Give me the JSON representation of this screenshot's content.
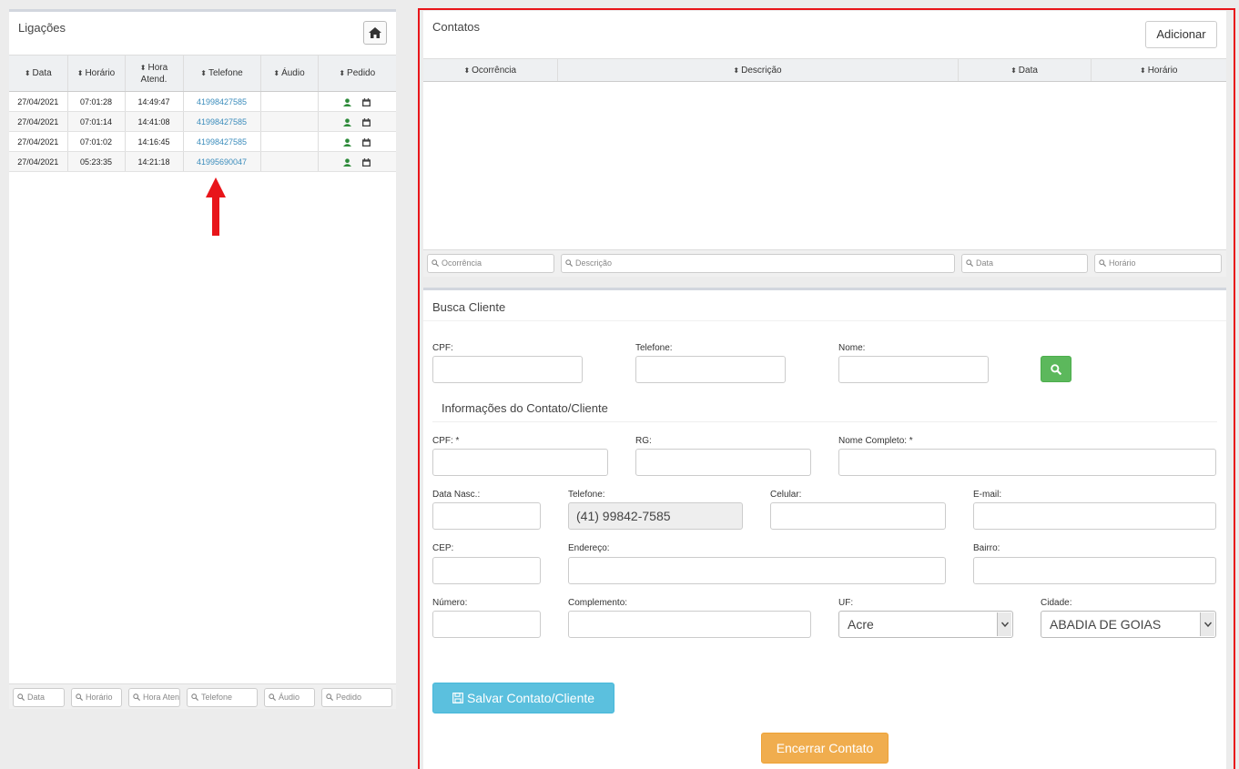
{
  "calls_panel": {
    "title": "Ligações",
    "columns": [
      "Data",
      "Horário",
      "Hora Atend.",
      "Telefone",
      "Áudio",
      "Pedido"
    ],
    "rows": [
      {
        "data": "27/04/2021",
        "horario": "07:01:28",
        "hora_atend": "14:49:47",
        "telefone": "41998427585"
      },
      {
        "data": "27/04/2021",
        "horario": "07:01:14",
        "hora_atend": "14:41:08",
        "telefone": "41998427585"
      },
      {
        "data": "27/04/2021",
        "horario": "07:01:02",
        "hora_atend": "14:16:45",
        "telefone": "41998427585"
      },
      {
        "data": "27/04/2021",
        "horario": "05:23:35",
        "hora_atend": "14:21:18",
        "telefone": "41995690047"
      }
    ],
    "filters": [
      "Data",
      "Horário",
      "Hora Atend.",
      "Telefone",
      "Áudio",
      "Pedido"
    ]
  },
  "contacts_panel": {
    "title": "Contatos",
    "add_label": "Adicionar",
    "columns": [
      "Ocorrência",
      "Descrição",
      "Data",
      "Horário"
    ],
    "filters": [
      "Ocorrência",
      "Descrição",
      "Data",
      "Horário"
    ]
  },
  "search_panel": {
    "title": "Busca Cliente",
    "cpf_label": "CPF:",
    "telefone_label": "Telefone:",
    "nome_label": "Nome:"
  },
  "info_panel": {
    "title": "Informações do Contato/Cliente",
    "cpf_label": "CPF: *",
    "rg_label": "RG:",
    "nome_completo_label": "Nome Completo: *",
    "data_nasc_label": "Data Nasc.:",
    "telefone_label": "Telefone:",
    "telefone_value": "(41) 99842-7585",
    "celular_label": "Celular:",
    "email_label": "E-mail:",
    "cep_label": "CEP:",
    "endereco_label": "Endereço:",
    "bairro_label": "Bairro:",
    "numero_label": "Número:",
    "complemento_label": "Complemento:",
    "uf_label": "UF:",
    "uf_value": "Acre",
    "cidade_label": "Cidade:",
    "cidade_value": "ABADIA DE GOIAS",
    "save_label": "Salvar Contato/Cliente",
    "end_label": "Encerrar Contato"
  },
  "colors": {
    "accent_green": "#5cb85c",
    "info_blue": "#5bc0de",
    "warning_orange": "#f0ad4e",
    "highlight_red": "#e8151a",
    "link_blue": "#3c8dbc"
  }
}
